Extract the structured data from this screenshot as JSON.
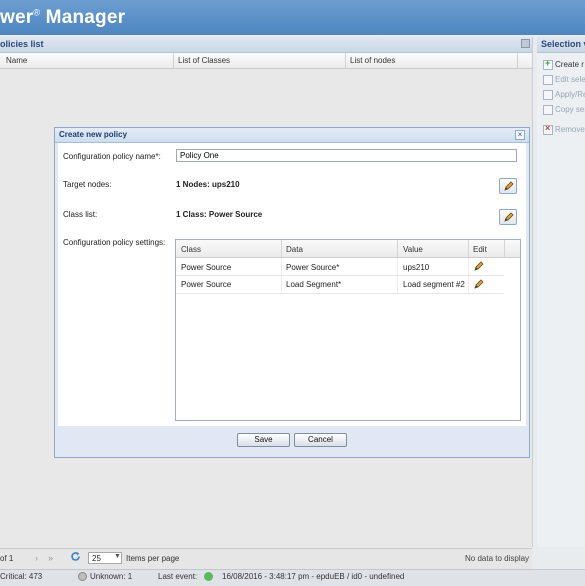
{
  "app": {
    "title_prefix": "wer",
    "title_suffix": " Manager",
    "registered_mark": "®"
  },
  "left_panel": {
    "title": "olicies list",
    "columns": [
      "Name",
      "List of Classes",
      "List of nodes"
    ]
  },
  "right_panel": {
    "title": "Selection vi",
    "items": [
      {
        "label": "Create r",
        "icon": "add-icon"
      },
      {
        "label": "Edit sele",
        "icon": "edit-icon"
      },
      {
        "label": "Apply/Re",
        "icon": "apply-icon"
      },
      {
        "label": "Copy sel",
        "icon": "copy-icon"
      },
      {
        "label": "Remove",
        "icon": "remove-icon"
      }
    ]
  },
  "pager": {
    "page_text": "of 1",
    "per_page_value": "25",
    "per_page_label": "Items per page",
    "empty_text": "No data to display"
  },
  "status_bar": {
    "critical": "Critical: 473",
    "unknown": "Unknown: 1",
    "last_event_label": "Last event:",
    "last_event_value": "16/08/2016 - 3:48:17 pm - epduEB / id0 - undefined",
    "critical_color": "#d9534f",
    "ok_color": "#5cb85c"
  },
  "dialog": {
    "title": "Create new policy",
    "name_label": "Configuration policy name*:",
    "name_value": "Policy One",
    "nodes_label": "Target nodes:",
    "nodes_value": "1 Nodes: ups210",
    "classes_label": "Class list:",
    "classes_value": "1 Class: Power Source",
    "settings_label": "Configuration policy settings:",
    "grid": {
      "columns": [
        "Class",
        "Data",
        "Value",
        "Edit"
      ],
      "rows": [
        {
          "class": "Power Source",
          "data": "Power Source*",
          "value": "ups210"
        },
        {
          "class": "Power Source",
          "data": "Load Segment*",
          "value": "Load segment #2"
        }
      ]
    },
    "save_label": "Save",
    "cancel_label": "Cancel"
  }
}
